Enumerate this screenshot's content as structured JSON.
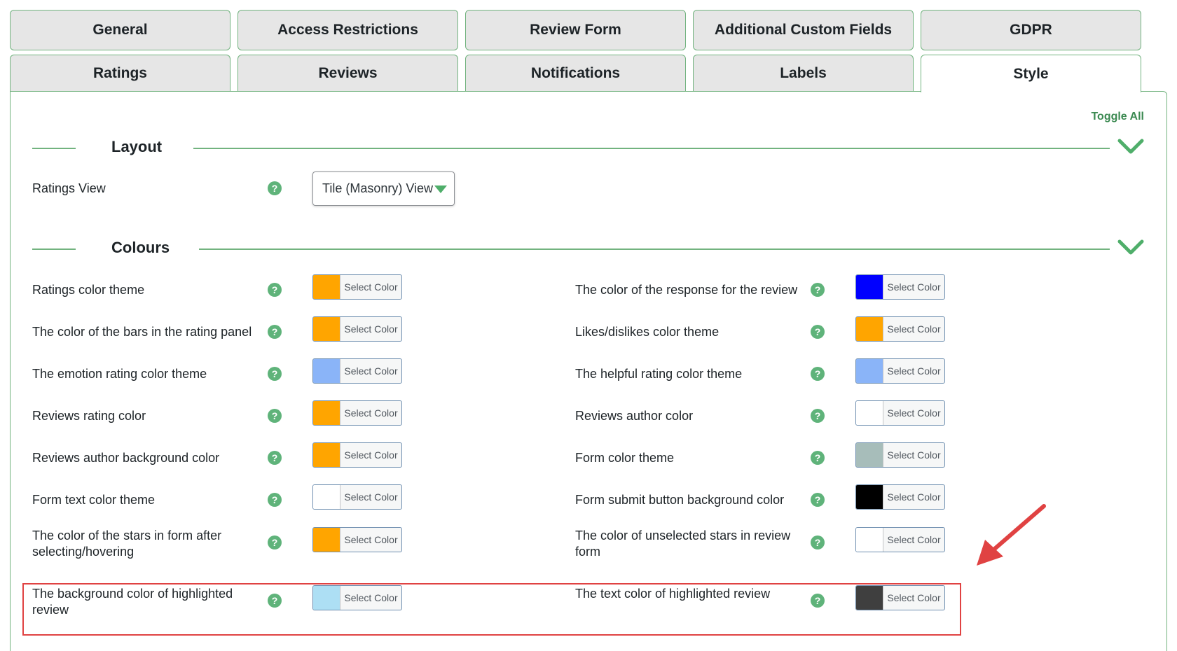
{
  "tabs_row1": [
    "General",
    "Access Restrictions",
    "Review Form",
    "Additional Custom Fields",
    "GDPR"
  ],
  "tabs_row2": [
    "Ratings",
    "Reviews",
    "Notifications",
    "Labels",
    "Style"
  ],
  "active_tab": "Style",
  "toggle_all": "Toggle All",
  "help_glyph": "?",
  "layout": {
    "title": "Layout",
    "ratings_view_label": "Ratings View",
    "ratings_view_value": "Tile (Masonry) View"
  },
  "colours": {
    "title": "Colours",
    "button_label": "Select Color",
    "left": [
      {
        "label": "Ratings color theme",
        "color": "#FFA500"
      },
      {
        "label": "The color of the bars in the rating panel",
        "color": "#FFA500"
      },
      {
        "label": "The emotion rating color theme",
        "color": "#8AB4F8"
      },
      {
        "label": "Reviews rating color",
        "color": "#FFA500"
      },
      {
        "label": "Reviews author background color",
        "color": "#FFA500"
      },
      {
        "label": "Form text color theme",
        "color": "#FFFFFF"
      },
      {
        "label": "The color of the stars in form after selecting/hovering",
        "color": "#FFA500"
      },
      {
        "label": "The background color of highlighted review",
        "color": "#ADDFF4"
      }
    ],
    "right": [
      {
        "label": "The color of the response for the review",
        "color": "#0000FF"
      },
      {
        "label": "Likes/dislikes color theme",
        "color": "#FFA500"
      },
      {
        "label": "The helpful rating color theme",
        "color": "#8AB4F8"
      },
      {
        "label": "Reviews author color",
        "color": "#FFFFFF"
      },
      {
        "label": "Form color theme",
        "color": "#A7BDBA"
      },
      {
        "label": "Form submit button background color",
        "color": "#000000"
      },
      {
        "label": "The color of unselected stars in review form",
        "color": "#FFFFFF"
      },
      {
        "label": "The text color of highlighted review",
        "color": "#3F3F3F"
      }
    ]
  },
  "accent_color": "#72B37F",
  "highlight_color": "#E04242"
}
